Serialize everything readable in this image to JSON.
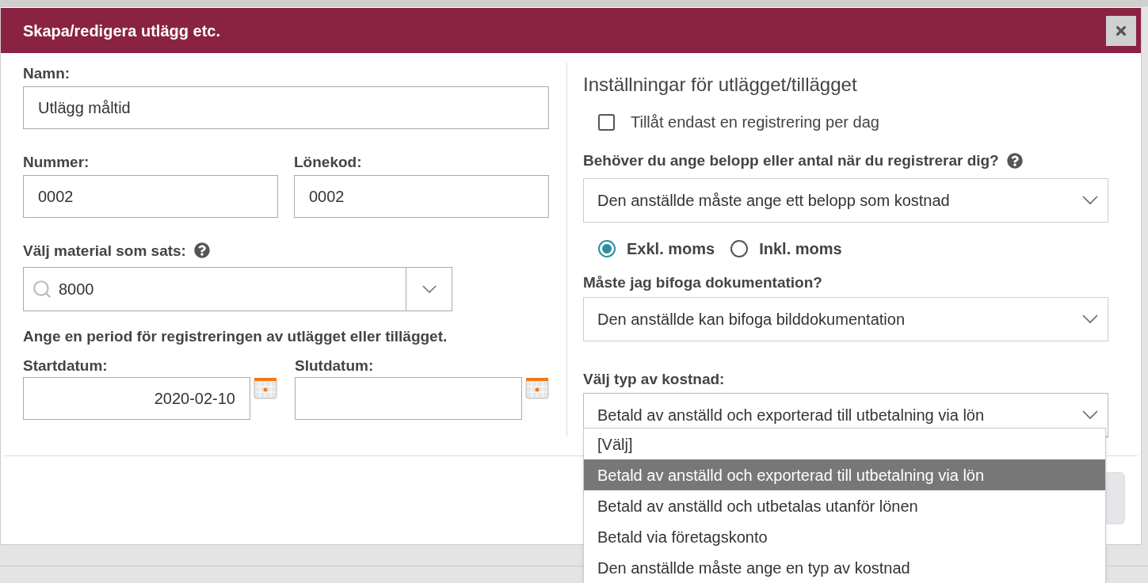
{
  "dialog": {
    "title": "Skapa/redigera utlägg etc."
  },
  "left": {
    "name": {
      "label": "Namn:",
      "value": "Utlägg måltid"
    },
    "number": {
      "label": "Nummer:",
      "value": "0002"
    },
    "salary_code": {
      "label": "Lönekod:",
      "value": "0002"
    },
    "material": {
      "label": "Välj material som sats:",
      "value": "8000"
    },
    "period_text": "Ange en period för registreringen av utlägget eller tillägget.",
    "start_date": {
      "label": "Startdatum:",
      "value": "2020-02-10"
    },
    "end_date": {
      "label": "Slutdatum:"
    }
  },
  "right": {
    "heading": "Inställningar för utlägget/tillägget",
    "one_per_day": {
      "label": "Tillåt endast en registrering per dag",
      "checked": false
    },
    "amount": {
      "label": "Behöver du ange belopp eller antal när du registrerar dig?",
      "value": "Den anställde måste ange ett belopp som kostnad"
    },
    "vat_options": [
      {
        "label": "Exkl. moms",
        "selected": true
      },
      {
        "label": "Inkl. moms",
        "selected": false
      }
    ],
    "documentation": {
      "label": "Måste jag bifoga dokumentation?",
      "value": "Den anställde kan bifoga bilddokumentation"
    },
    "cost_type": {
      "label": "Välj typ av kostnad:",
      "value": "Betald av anställd och exporterad till utbetalning via lön",
      "expanded": true,
      "options": [
        {
          "label": "[Välj]",
          "selected": false
        },
        {
          "label": "Betald av anställd och exporterad till utbetalning via lön",
          "selected": true
        },
        {
          "label": "Betald av anställd och utbetalas utanför lönen",
          "selected": false
        },
        {
          "label": "Betald via företagskonto",
          "selected": false
        },
        {
          "label": "Den anställde måste ange en typ av kostnad",
          "selected": false
        }
      ]
    }
  }
}
